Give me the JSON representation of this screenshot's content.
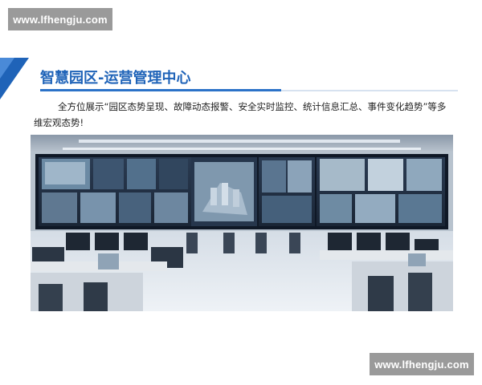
{
  "watermark": {
    "top_text": "www.lfhengju.com",
    "bottom_text": "www.lfhengju.com"
  },
  "header": {
    "title": "智慧园区-运营管理中心"
  },
  "description": {
    "text": "全方位展示“园区态势呈现、故障动态报警、安全实时监控、统计信息汇总、事件变化趋势”等多维宏观态势!"
  },
  "colors": {
    "accent": "#1f63b8",
    "accent_dark": "#1a4f96",
    "watermark_bg": "#9a9a9a"
  },
  "image": {
    "subject": "control-room-video-wall"
  }
}
